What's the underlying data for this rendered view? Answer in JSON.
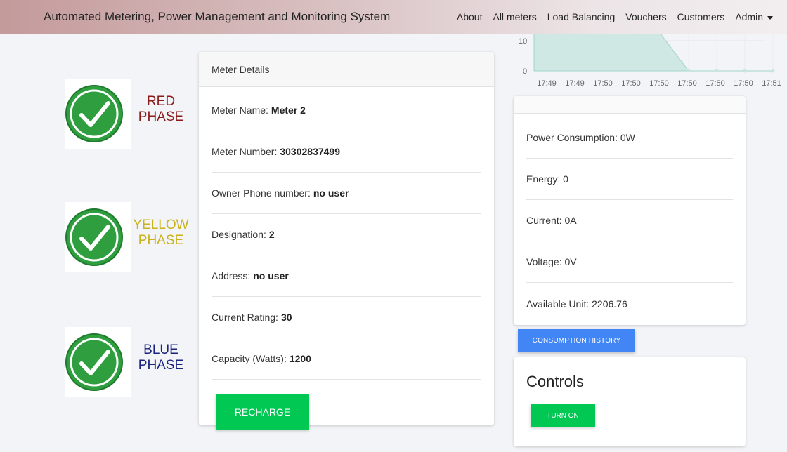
{
  "navbar": {
    "brand": "Automated Metering, Power Management and Monitoring System",
    "links": [
      "About",
      "All meters",
      "Load Balancing",
      "Vouchers",
      "Customers"
    ],
    "admin": "Admin"
  },
  "phases": {
    "red": {
      "line1": "RED",
      "line2": "PHASE",
      "color": "#8b1a1a"
    },
    "yellow": {
      "line1": "YELLOW",
      "line2": "PHASE",
      "color": "#c9b21a"
    },
    "blue": {
      "line1": "BLUE",
      "line2": "PHASE",
      "color": "#1a237e"
    }
  },
  "meter_card": {
    "header": "Meter Details",
    "rows": [
      {
        "label": "Meter Name:",
        "value": "Meter 2"
      },
      {
        "label": "Meter Number:",
        "value": "30302837499"
      },
      {
        "label": "Owner Phone number:",
        "value": "no user"
      },
      {
        "label": "Designation:",
        "value": "2"
      },
      {
        "label": "Address:",
        "value": "no user"
      },
      {
        "label": "Current Rating:",
        "value": "30"
      },
      {
        "label": "Capacity (Watts):",
        "value": "1200"
      }
    ],
    "recharge_label": "RECHARGE"
  },
  "stats": [
    "Power Consumption: 0W",
    "Energy: 0",
    "Current: 0A",
    "Voltage: 0V",
    "Available Unit: 2206.76"
  ],
  "consumption_history_label": "CONSUMPTION HISTORY",
  "controls": {
    "title": "Controls",
    "turn_on_label": "TURN ON"
  },
  "colors": {
    "green_button": "#00c853",
    "blue_button": "#4285f4",
    "check_green": "#2e9e3e",
    "chart_fill": "#cfe8e4"
  },
  "chart_data": {
    "type": "area",
    "x": [
      "17:49",
      "17:49",
      "17:50",
      "17:50",
      "17:50",
      "17:50",
      "17:50",
      "17:50",
      "17:51"
    ],
    "values": [
      10,
      10,
      10,
      10,
      10,
      0,
      0,
      0,
      0
    ],
    "ytick_labels": [
      "10",
      "0"
    ],
    "ylim": [
      0,
      10
    ]
  }
}
